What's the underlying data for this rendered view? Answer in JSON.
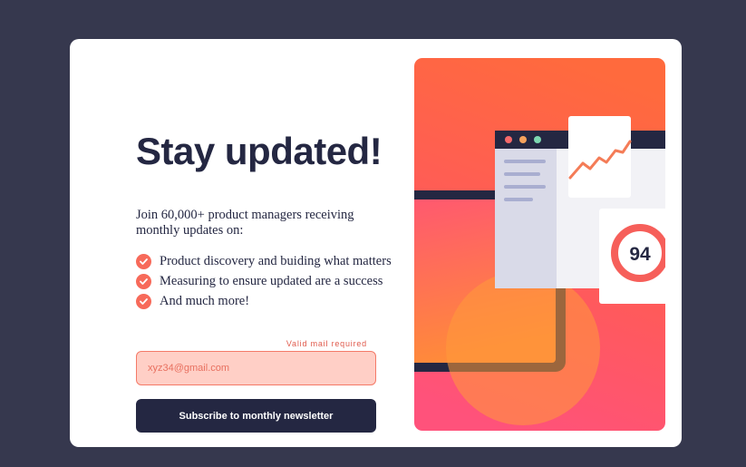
{
  "signup": {
    "title": "Stay updated!",
    "intro": "Join 60,000+ product managers receiving monthly updates on:",
    "features": [
      "Product discovery and buiding what matters",
      "Measuring to ensure updated are a success",
      "And much more!"
    ],
    "email_error": "Valid mail required",
    "email_value": "xyz34@gmail.com",
    "subscribe_label": "Subscribe to monthly newsletter"
  },
  "illustration": {
    "score": "94"
  },
  "colors": {
    "background": "#36384e",
    "navy": "#242742",
    "tomato": "#f76a5a",
    "error_fill": "#ffcfc6"
  },
  "icons": [
    "check-icon",
    "window-dots-icon",
    "trend-line-icon",
    "score-ring-icon"
  ]
}
